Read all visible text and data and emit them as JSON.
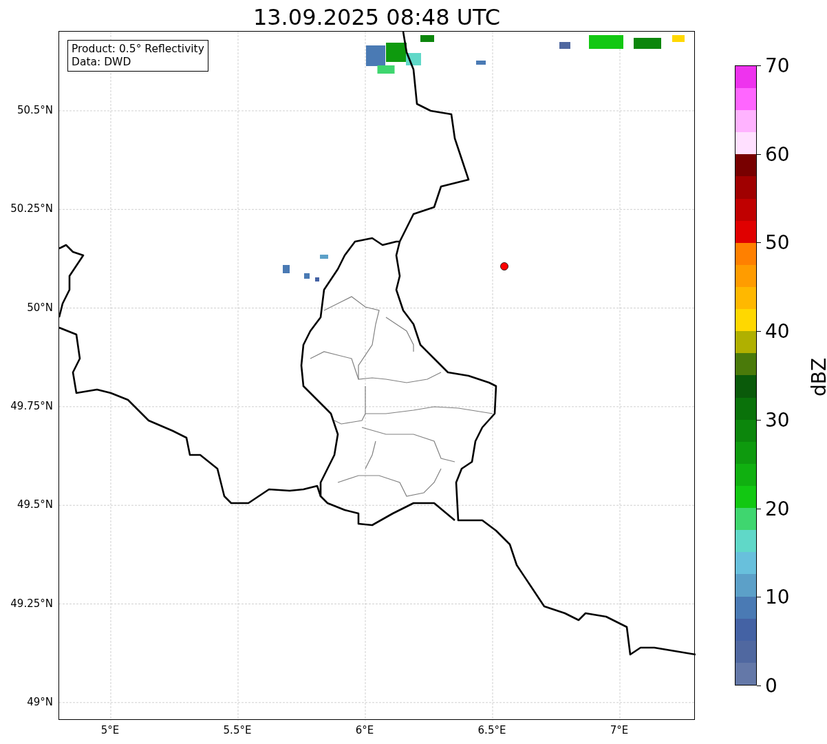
{
  "title": "13.09.2025 08:48 UTC",
  "map": {
    "legend": [
      "Product: 0.5° Reflectivity",
      "Data: DWD"
    ],
    "y_ticks": [
      "50.5°N",
      "50.25°N",
      "50°N",
      "49.75°N",
      "49.5°N",
      "49.25°N",
      "49°N"
    ],
    "x_ticks": [
      "5°E",
      "5.5°E",
      "6°E",
      "6.5°E",
      "7°E"
    ]
  },
  "colorbar": {
    "label": "dBZ",
    "ticks": [
      "70",
      "60",
      "50",
      "40",
      "30",
      "20",
      "10",
      "0"
    ],
    "bins": [
      {
        "color": "#6478a8"
      },
      {
        "color": "#5068a0"
      },
      {
        "color": "#4462a4"
      },
      {
        "color": "#4a7ab4"
      },
      {
        "color": "#5ca0c8"
      },
      {
        "color": "#68c0dc"
      },
      {
        "color": "#60d8c8"
      },
      {
        "color": "#3fd66f"
      },
      {
        "color": "#12c812"
      },
      {
        "color": "#10b010"
      },
      {
        "color": "#0e9a0e"
      },
      {
        "color": "#0c860c"
      },
      {
        "color": "#0a720a"
      },
      {
        "color": "#0a5a0a"
      },
      {
        "color": "#4a7a0a"
      },
      {
        "color": "#b0b000"
      },
      {
        "color": "#ffd800"
      },
      {
        "color": "#ffb800"
      },
      {
        "color": "#ff9c00"
      },
      {
        "color": "#ff8000"
      },
      {
        "color": "#e00000"
      },
      {
        "color": "#c00000"
      },
      {
        "color": "#a00000"
      },
      {
        "color": "#780000"
      },
      {
        "color": "#ffe0ff"
      },
      {
        "color": "#ffb3ff"
      },
      {
        "color": "#ff66ff"
      },
      {
        "color": "#ee33ee"
      }
    ]
  }
}
